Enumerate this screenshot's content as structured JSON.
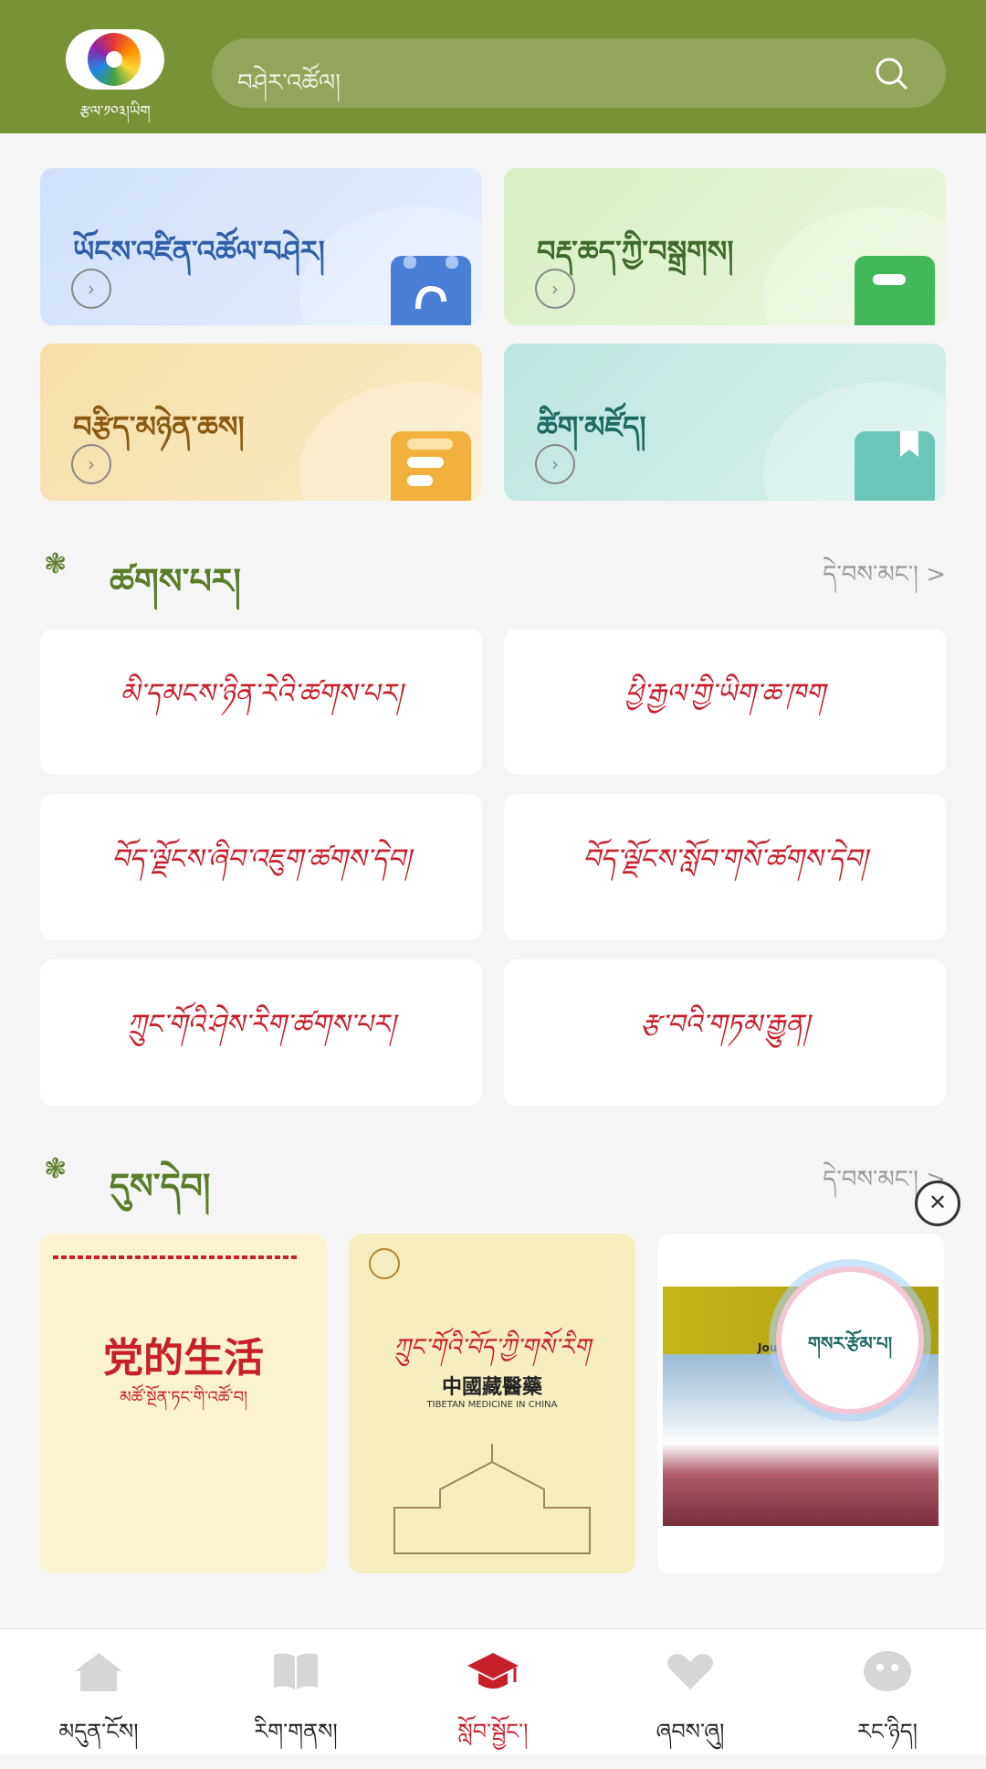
{
  "header": {
    "logo_text": "རྩལ་༡༠༣།ཡིག",
    "search_placeholder": "བཤེར་འཚོལ།"
  },
  "quick_cards": [
    {
      "title": "ཡོངས་འཛིན་འཚོལ་བཤེར།",
      "title_color": "#2f5fa8"
    },
    {
      "title": "བརྡ་ཆད་ཀྱི་བསྒྲགས།",
      "title_color": "#3c6b2a"
    },
    {
      "title": "བརྩིད་མཉེན་ཆས།",
      "title_color": "#8a5a10"
    },
    {
      "title": "ཚིག་མཛོད།",
      "title_color": "#1f6b63"
    }
  ],
  "section_1": {
    "title": "ཚགས་པར།",
    "more": "དེ་བས་མང་། >"
  },
  "journals": [
    "མི་དམངས་ཉིན་རེའི་ཚགས་པར།",
    "ཕྱི་རྒྱལ་གྱི་ཡིག་ཆ་ཁག",
    "བོད་ལྗོངས་ཞིབ་འཇུག་ཚགས་དེབ།",
    "བོད་ལྗོངས་སློབ་གསོ་ཚགས་དེབ།",
    "ཀྲུང་གོའི་ཤེས་རིག་ཚགས་པར།",
    "རྩ་བའི་གཏམ་རྒྱུན།"
  ],
  "section_2": {
    "title": "དུས་དེབ།",
    "more": "དེ་བས་མང་། >"
  },
  "books": [
    {
      "title_cn": "党的生活",
      "subtitle": "མཚོ་སྔོན་ཏང་གི་འཚོ་བ།"
    },
    {
      "title_tb": "ཀྲུང་གོའི་བོད་ཀྱི་གསོ་རིག",
      "title_cn": "中國藏醫藥",
      "title_en": "TIBETAN MEDICINE IN CHINA"
    },
    {
      "top_text": "Journal of Q",
      "overlay": "གསར་རྩོམ་པ།"
    }
  ],
  "tabbar": [
    {
      "label": "མདུན་ངོས།"
    },
    {
      "label": "རིག་གནས།"
    },
    {
      "label": "སློབ་སྦྱོང་།"
    },
    {
      "label": "ཞབས་ཞུ།"
    },
    {
      "label": "རང་ཉིད།"
    }
  ],
  "colors": {
    "header": "#7a9236",
    "accent_red": "#c8202a",
    "section_green": "#5a7d2a"
  }
}
